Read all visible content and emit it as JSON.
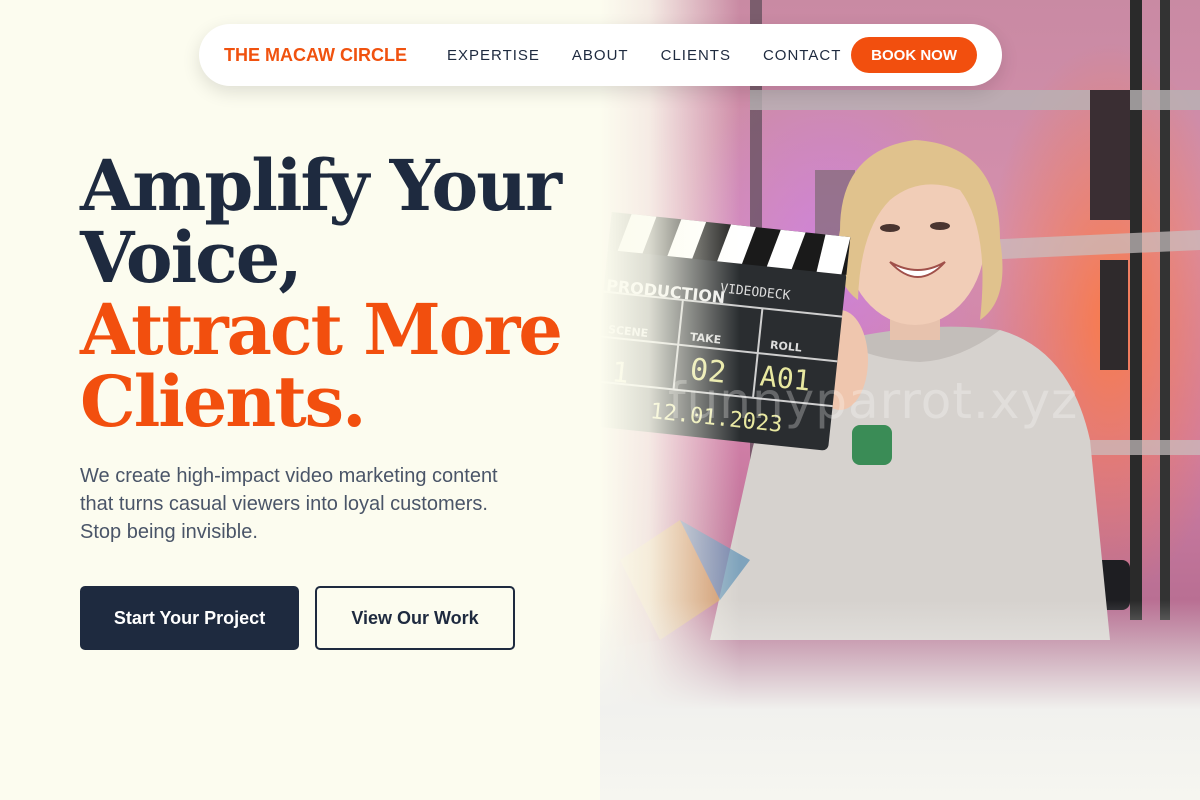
{
  "nav": {
    "brand": "THE MACAW CIRCLE",
    "links": [
      "EXPERTISE",
      "ABOUT",
      "CLIENTS",
      "CONTACT"
    ],
    "cta": "BOOK NOW"
  },
  "hero": {
    "headline_line1": "Amplify Your",
    "headline_line2": "Voice,",
    "accent_line1": "Attract More",
    "accent_line2": "Clients.",
    "subtext": "We create high-impact video marketing content that turns casual viewers into loyal customers. Stop being invisible.",
    "primary_button": "Start Your Project",
    "secondary_button": "View Our Work",
    "image_watermark": "funnyparrot.xyz",
    "clapper": {
      "production": "PRODUCTION",
      "title": "VIDEODECK",
      "scene_label": "SCENE",
      "take_label": "TAKE",
      "roll_label": "ROLL",
      "scene": "1",
      "take": "02",
      "roll": "A01",
      "date": "12.01.2023"
    }
  },
  "colors": {
    "brand_orange": "#f24f0e",
    "navy": "#1e2a3f",
    "background": "#fcfcef"
  }
}
